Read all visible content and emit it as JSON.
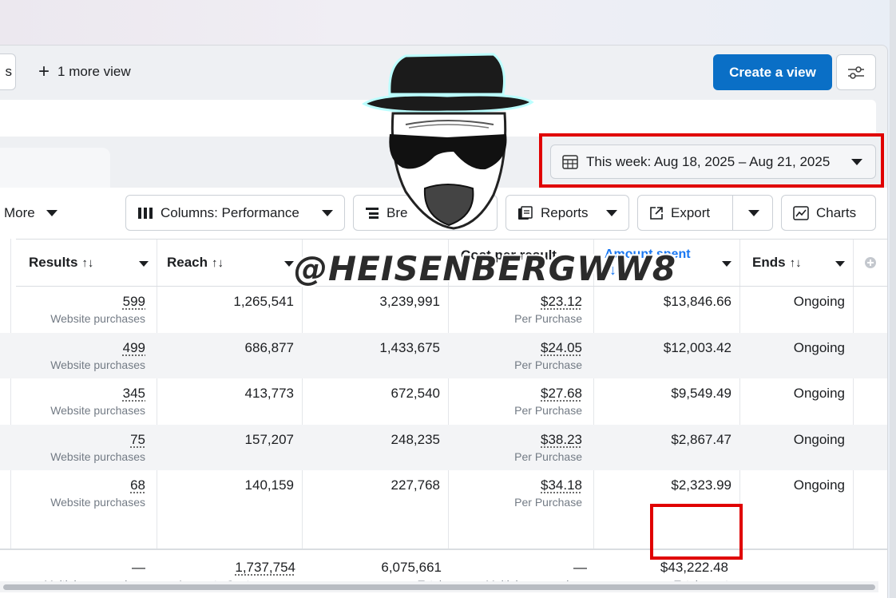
{
  "header": {
    "partial_tab_text": "s",
    "more_view_label": "1 more view",
    "create_view_label": "Create a view"
  },
  "date_range": {
    "label": "This week: Aug 18, 2025 – Aug 21, 2025"
  },
  "toolbar": {
    "more_label": "More",
    "columns_label": "Columns: Performance",
    "breakdown_label": "Bre",
    "reports_label": "Reports",
    "export_label": "Export",
    "charts_label": "Charts"
  },
  "table": {
    "headers": {
      "results": "Results",
      "reach": "Reach",
      "cost_per_result": "Cost per result",
      "amount_spent": "Amount spent",
      "ends": "Ends"
    },
    "sort_glyph": "↑↓",
    "active_sort_glyph": "↓",
    "rows": [
      {
        "results": "599",
        "results_sub": "Website purchases",
        "reach": "1,265,541",
        "impressions": "3,239,991",
        "cost": "$23.12",
        "cost_sub": "Per Purchase",
        "spent": "$13,846.66",
        "ends": "Ongoing"
      },
      {
        "results": "499",
        "results_sub": "Website purchases",
        "reach": "686,877",
        "impressions": "1,433,675",
        "cost": "$24.05",
        "cost_sub": "Per Purchase",
        "spent": "$12,003.42",
        "ends": "Ongoing"
      },
      {
        "results": "345",
        "results_sub": "Website purchases",
        "reach": "413,773",
        "impressions": "672,540",
        "cost": "$27.68",
        "cost_sub": "Per Purchase",
        "spent": "$9,549.49",
        "ends": "Ongoing"
      },
      {
        "results": "75",
        "results_sub": "Website purchases",
        "reach": "157,207",
        "impressions": "248,235",
        "cost": "$38.23",
        "cost_sub": "Per Purchase",
        "spent": "$2,867.47",
        "ends": "Ongoing"
      },
      {
        "results": "68",
        "results_sub": "Website purchases",
        "reach": "140,159",
        "impressions": "227,768",
        "cost": "$34.18",
        "cost_sub": "Per Purchase",
        "spent": "$2,323.99",
        "ends": "Ongoing"
      }
    ],
    "totals": {
      "results": "—",
      "results_sub": "Multiple conversions",
      "reach": "1,737,754",
      "reach_sub": "Accounts Center acco...",
      "impressions": "6,075,661",
      "impressions_sub": "Total",
      "cost": "—",
      "cost_sub": "Multiple conversions",
      "spent": "$43,222.48",
      "spent_sub": "Total spent"
    }
  },
  "overlay": {
    "watermark": "@HEISENBERGWW8"
  },
  "colors": {
    "primary": "#0a6fc6",
    "highlight": "#e00000",
    "active_header": "#1877f2"
  }
}
